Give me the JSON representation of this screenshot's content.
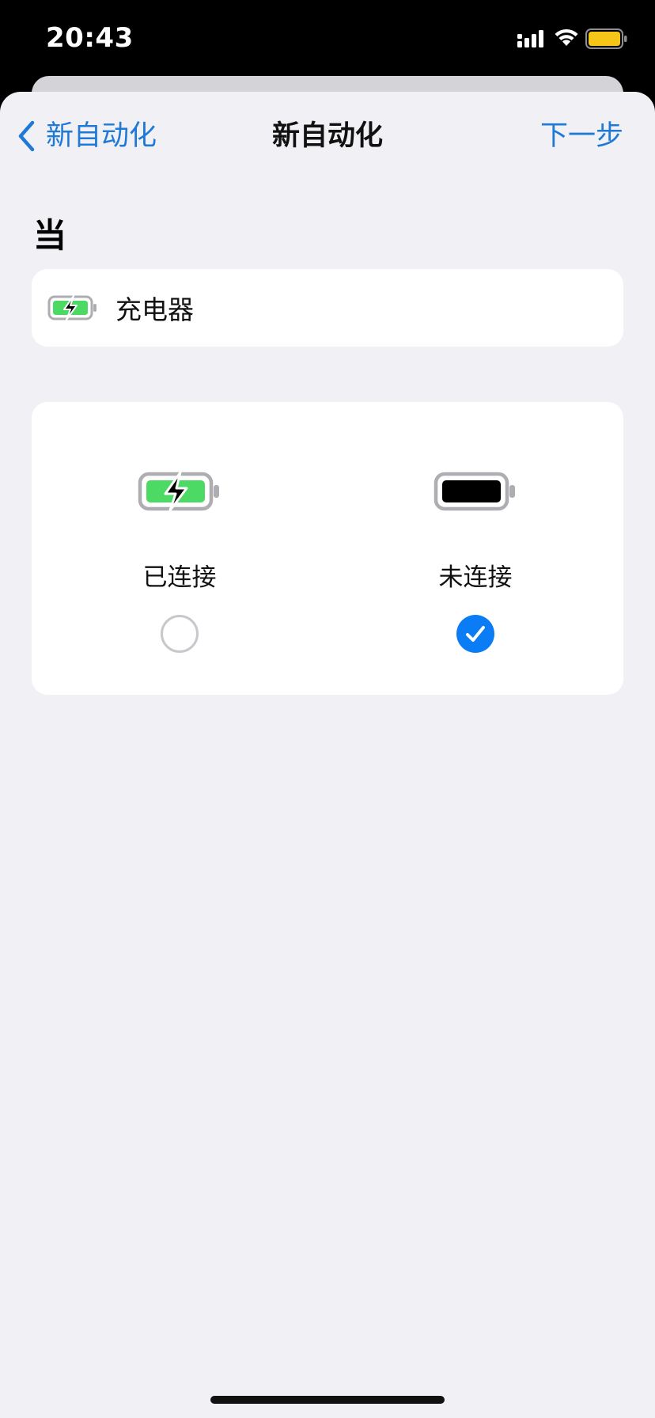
{
  "status_bar": {
    "time": "20:43",
    "signal_icon": "cellular-signal-icon",
    "wifi_icon": "wifi-icon",
    "battery_icon": "battery-icon",
    "battery_color": "#f5c518"
  },
  "nav": {
    "back_label": "新自动化",
    "title": "新自动化",
    "next_label": "下一步",
    "accent_color": "#1e7ad6"
  },
  "section": {
    "header": "当"
  },
  "trigger": {
    "icon": "battery-charging-icon",
    "label": "充电器"
  },
  "options": [
    {
      "label": "已连接",
      "icon": "battery-charging-icon",
      "selected": false
    },
    {
      "label": "未连接",
      "icon": "battery-full-icon",
      "selected": true
    }
  ],
  "colors": {
    "sheet_background": "#f0f0f5",
    "selected_radio": "#0a7cf5",
    "charging_green": "#4cd964"
  }
}
